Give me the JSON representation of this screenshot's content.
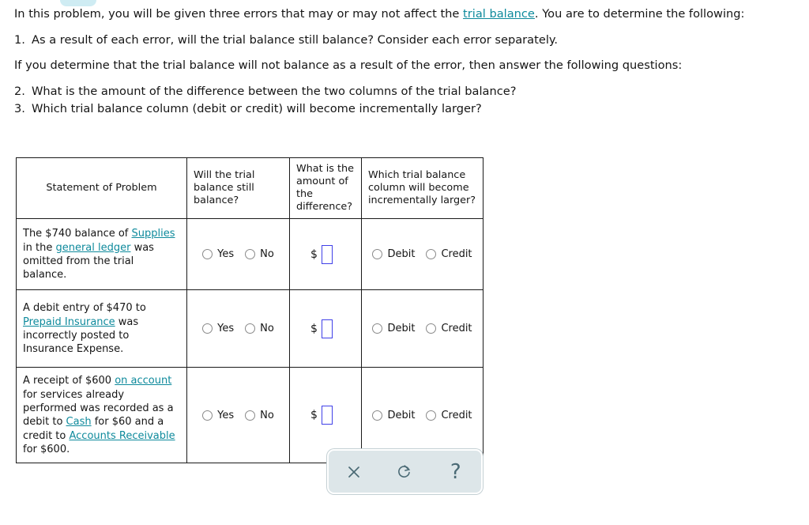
{
  "decor": {
    "pill": "top-pill-shape"
  },
  "intro": {
    "line1_a": "In this problem, you will be given three errors that may or may not affect the ",
    "line1_link": "trial balance",
    "line1_b": ". You are to determine the following:",
    "item1_num": "1.",
    "item1_text": "As a result of each error, will the trial balance still balance? Consider each error separately.",
    "line2": "If you determine that the trial balance will not balance as a result of the error, then answer the following questions:",
    "item2_num": "2.",
    "item2_text": "What is the amount of the difference between the two columns of the trial balance?",
    "item3_num": "3.",
    "item3_text": "Which trial balance column (debit or credit) will become incrementally larger?"
  },
  "table": {
    "headers": [
      "Statement of Problem",
      "Will the trial balance still balance?",
      "What is the amount of the difference?",
      "Which trial balance column will become incrementally larger?"
    ],
    "rows": [
      {
        "statement": {
          "p1": "The $740 balance of ",
          "l1": "Supplies",
          "p2": " in the ",
          "l2": "general ledger",
          "p3": " was omitted from the trial balance.",
          "p4": "",
          "l3": "",
          "p5": "",
          "l4": "",
          "p6": ""
        },
        "yes": "Yes",
        "no": "No",
        "dollar": "$",
        "amount_value": "",
        "amount_placeholder": "",
        "debit": "Debit",
        "credit": "Credit"
      },
      {
        "statement": {
          "p1": "A debit entry of $470 to ",
          "l1": "Prepaid Insurance",
          "p2": " was incorrectly posted to Insurance Expense.",
          "p3": "",
          "l2": "",
          "p4": "",
          "l3": "",
          "p5": "",
          "l4": "",
          "p6": ""
        },
        "yes": "Yes",
        "no": "No",
        "dollar": "$",
        "amount_value": "",
        "amount_placeholder": "",
        "debit": "Debit",
        "credit": "Credit"
      },
      {
        "statement": {
          "p1": "A receipt of $600 ",
          "l1": "on account",
          "p2": " for services already performed was recorded as a debit to ",
          "l2": "Cash",
          "p3": " for $60 and a credit to ",
          "l3": "Accounts Receivable",
          "p4": " for $600.",
          "p5": "",
          "l4": "",
          "p6": ""
        },
        "yes": "Yes",
        "no": "No",
        "dollar": "$",
        "amount_value": "",
        "amount_placeholder": "",
        "debit": "Debit",
        "credit": "Credit"
      }
    ]
  },
  "toolbar": {
    "clear_icon": "close-x-icon",
    "undo_icon": "counterclockwise-refresh-icon",
    "help_icon": "question-mark-icon",
    "help_glyph": "?"
  },
  "colors": {
    "link": "#0e8a9c",
    "input_border": "#4040e8",
    "toolbar_bg": "#dde6e9",
    "toolbar_icon": "#4a6a75",
    "table_border": "#1a1a1a",
    "pill": "#cfecf3"
  }
}
